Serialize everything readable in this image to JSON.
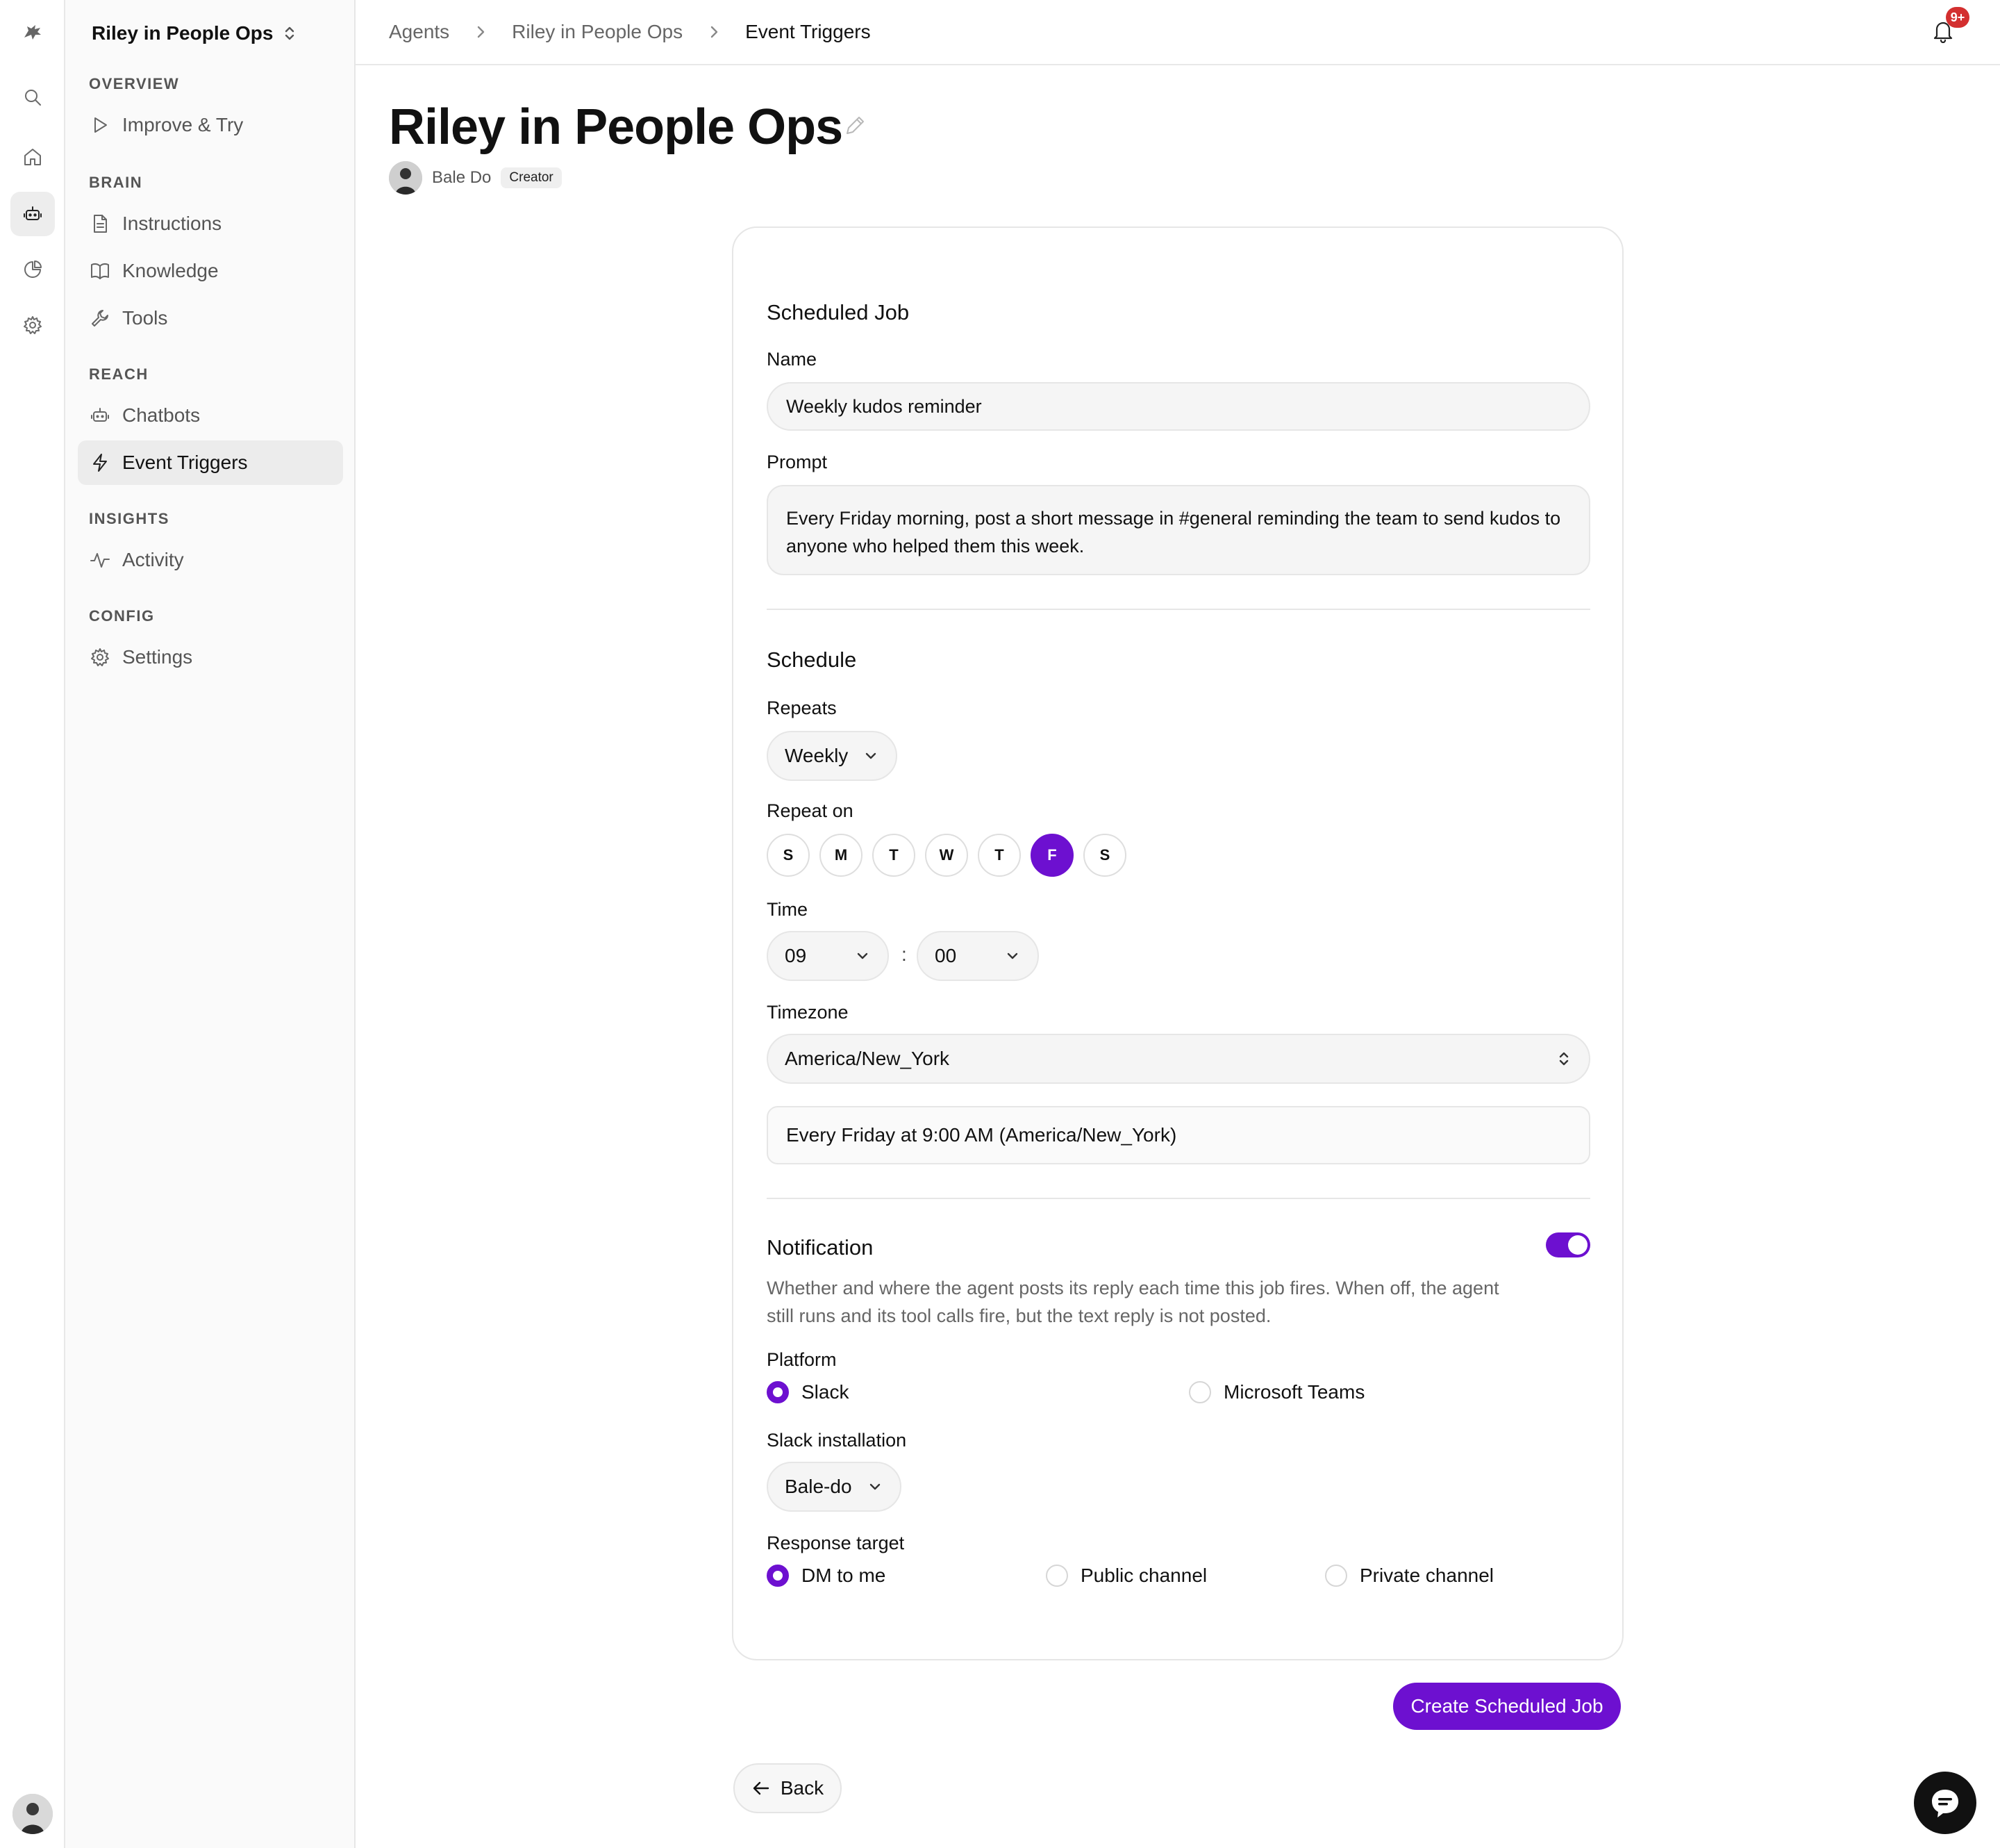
{
  "rail": {
    "icons": [
      "logo-icon",
      "search-icon",
      "home-icon",
      "agent-icon",
      "analytics-icon",
      "settings-icon"
    ]
  },
  "sidebar": {
    "workspace": "Riley in People Ops",
    "sections": {
      "overview": "OVERVIEW",
      "brain": "BRAIN",
      "reach": "REACH",
      "insights": "INSIGHTS",
      "config": "CONFIG"
    },
    "items": {
      "improve": "Improve & Try",
      "instructions": "Instructions",
      "knowledge": "Knowledge",
      "tools": "Tools",
      "chatbots": "Chatbots",
      "event_triggers": "Event Triggers",
      "activity": "Activity",
      "settings": "Settings"
    },
    "active_item": "Event Triggers"
  },
  "breadcrumb": [
    "Agents",
    "Riley in People Ops",
    "Event Triggers"
  ],
  "notifications": {
    "badge": "9+"
  },
  "header": {
    "title": "Riley in People Ops",
    "owner": "Bale Do",
    "owner_role": "Creator"
  },
  "form": {
    "job_heading": "Scheduled Job",
    "name_label": "Name",
    "name_value": "Weekly kudos reminder",
    "prompt_label": "Prompt",
    "prompt_value": "Every Friday morning, post a short message in #general reminding the team to send kudos to anyone who helped them this week.",
    "schedule_heading": "Schedule",
    "repeats_label": "Repeats",
    "repeats_value": "Weekly",
    "repeat_on_label": "Repeat on",
    "days": [
      "S",
      "M",
      "T",
      "W",
      "T",
      "F",
      "S"
    ],
    "selected_day_index": 5,
    "time_label": "Time",
    "time_hour": "09",
    "time_separator": ":",
    "time_minute": "00",
    "timezone_label": "Timezone",
    "timezone_value": "America/New_York",
    "summary": "Every Friday at 9:00 AM (America/New_York)",
    "notification_heading": "Notification",
    "notification_enabled": true,
    "notification_desc": "Whether and where the agent posts its reply each time this job fires. When off, the agent still runs and its tool calls fire, but the text reply is not posted.",
    "platform_label": "Platform",
    "platform_options": [
      "Slack",
      "Microsoft Teams"
    ],
    "platform_selected": "Slack",
    "installation_label": "Slack installation",
    "installation_value": "Bale-do",
    "response_label": "Response target",
    "response_options": [
      "DM to me",
      "Public channel",
      "Private channel"
    ],
    "response_selected": "DM to me"
  },
  "actions": {
    "create": "Create Scheduled Job",
    "back": "Back"
  },
  "colors": {
    "accent": "#6d10d0",
    "badge": "#d32f2f"
  }
}
